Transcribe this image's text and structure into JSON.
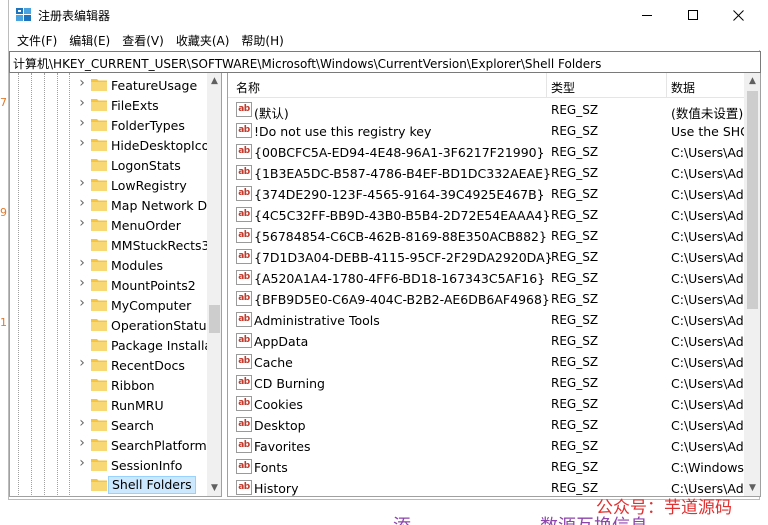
{
  "window": {
    "title": "注册表编辑器",
    "controls": {
      "minimize": "—",
      "maximize": "☐",
      "close": "✕"
    }
  },
  "menu": [
    "文件(F)",
    "编辑(E)",
    "查看(V)",
    "收藏夹(A)",
    "帮助(H)"
  ],
  "address": "计算机\\HKEY_CURRENT_USER\\SOFTWARE\\Microsoft\\Windows\\CurrentVersion\\Explorer\\Shell Folders",
  "tree": {
    "items": [
      {
        "label": "FeatureUsage",
        "expandable": true
      },
      {
        "label": "FileExts",
        "expandable": true
      },
      {
        "label": "FolderTypes",
        "expandable": true
      },
      {
        "label": "HideDesktopIco",
        "expandable": true
      },
      {
        "label": "LogonStats",
        "expandable": false
      },
      {
        "label": "LowRegistry",
        "expandable": true
      },
      {
        "label": "Map Network D",
        "expandable": true
      },
      {
        "label": "MenuOrder",
        "expandable": true
      },
      {
        "label": "MMStuckRects3",
        "expandable": false
      },
      {
        "label": "Modules",
        "expandable": true
      },
      {
        "label": "MountPoints2",
        "expandable": true
      },
      {
        "label": "MyComputer",
        "expandable": true
      },
      {
        "label": "OperationStatus",
        "expandable": false
      },
      {
        "label": "Package Installa",
        "expandable": false
      },
      {
        "label": "RecentDocs",
        "expandable": true
      },
      {
        "label": "Ribbon",
        "expandable": false
      },
      {
        "label": "RunMRU",
        "expandable": false
      },
      {
        "label": "Search",
        "expandable": true
      },
      {
        "label": "SearchPlatform",
        "expandable": true
      },
      {
        "label": "SessionInfo",
        "expandable": true
      },
      {
        "label": "Shell Folders",
        "expandable": false,
        "selected": true
      }
    ]
  },
  "list": {
    "columns": {
      "name": "名称",
      "type": "类型",
      "data": "数据"
    },
    "value_icon": "ab",
    "rows": [
      {
        "name": "(默认)",
        "type": "REG_SZ",
        "data": "(数值未设置)"
      },
      {
        "name": "!Do not use this registry key",
        "type": "REG_SZ",
        "data": "Use the SHG"
      },
      {
        "name": "{00BCFC5A-ED94-4E48-96A1-3F6217F21990}",
        "type": "REG_SZ",
        "data": "C:\\Users\\Adr"
      },
      {
        "name": "{1B3EA5DC-B587-4786-B4EF-BD1DC332AEAE}",
        "type": "REG_SZ",
        "data": "C:\\Users\\Adr"
      },
      {
        "name": "{374DE290-123F-4565-9164-39C4925E467B}",
        "type": "REG_SZ",
        "data": "C:\\Users\\Adr"
      },
      {
        "name": "{4C5C32FF-BB9D-43B0-B5B4-2D72E54EAAA4}",
        "type": "REG_SZ",
        "data": "C:\\Users\\Adr"
      },
      {
        "name": "{56784854-C6CB-462B-8169-88E350ACB882}",
        "type": "REG_SZ",
        "data": "C:\\Users\\Adr"
      },
      {
        "name": "{7D1D3A04-DEBB-4115-95CF-2F29DA2920DA}",
        "type": "REG_SZ",
        "data": "C:\\Users\\Adr"
      },
      {
        "name": "{A520A1A4-1780-4FF6-BD18-167343C5AF16}",
        "type": "REG_SZ",
        "data": "C:\\Users\\Adr"
      },
      {
        "name": "{BFB9D5E0-C6A9-404C-B2B2-AE6DB6AF4968}",
        "type": "REG_SZ",
        "data": "C:\\Users\\Adr"
      },
      {
        "name": "Administrative Tools",
        "type": "REG_SZ",
        "data": "C:\\Users\\Adr"
      },
      {
        "name": "AppData",
        "type": "REG_SZ",
        "data": "C:\\Users\\Adr"
      },
      {
        "name": "Cache",
        "type": "REG_SZ",
        "data": "C:\\Users\\Adr"
      },
      {
        "name": "CD Burning",
        "type": "REG_SZ",
        "data": "C:\\Users\\Adr"
      },
      {
        "name": "Cookies",
        "type": "REG_SZ",
        "data": "C:\\Users\\Adr"
      },
      {
        "name": "Desktop",
        "type": "REG_SZ",
        "data": "C:\\Users\\Adr"
      },
      {
        "name": "Favorites",
        "type": "REG_SZ",
        "data": "C:\\Users\\Adr"
      },
      {
        "name": "Fonts",
        "type": "REG_SZ",
        "data": "C:\\Windows\\"
      },
      {
        "name": "History",
        "type": "REG_SZ",
        "data": "C:\\Users\\Adr"
      }
    ]
  },
  "background": {
    "margin_numbers": [
      "7",
      "9",
      "1"
    ],
    "bottom_fragments": [
      "添",
      "数源互换信息"
    ]
  },
  "watermark": "公众号：芋道源码",
  "colors": {
    "selection": "#cce8ff",
    "watermark": "#e03030",
    "folder": "#f5c542",
    "icon_blue": "#1e73be"
  }
}
